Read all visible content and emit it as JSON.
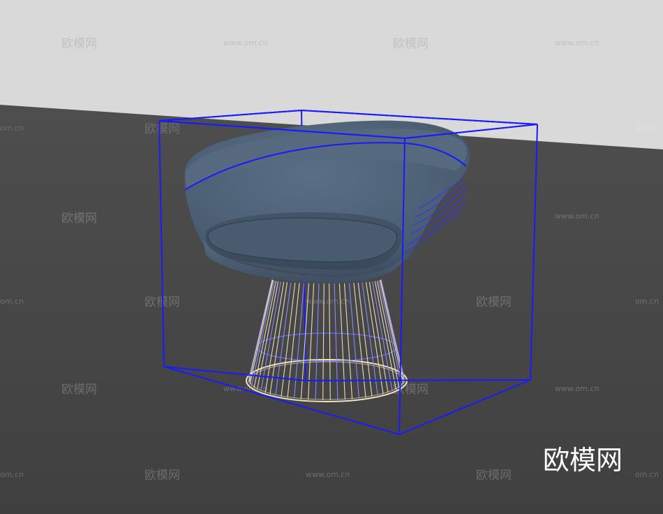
{
  "scene": {
    "colors": {
      "wall": "#d9d9d9",
      "floor": "#4a4a4a",
      "chair_fabric": "#4d6178",
      "chair_fabric_dark": "#3a4a5e",
      "bounding_box": "#1a1aff",
      "wire_base": "#e8dcb8"
    },
    "objects": [
      "chair-model",
      "bounding-box"
    ]
  },
  "watermarks": {
    "cn": "欧模网",
    "url": "www.om.cn",
    "url_partial": "om.cn"
  },
  "brand_logo": "欧模网"
}
